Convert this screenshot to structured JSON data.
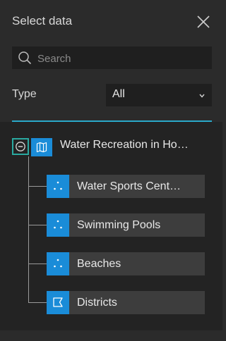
{
  "panel": {
    "title": "Select data",
    "close_icon": "close-icon"
  },
  "search": {
    "placeholder": "Search",
    "value": "",
    "icon": "search-icon"
  },
  "type_filter": {
    "label": "Type",
    "selected": "All",
    "icon": "chevron-down-icon"
  },
  "tree": {
    "parent": {
      "label": "Water Recreation in Ho…",
      "icon": "map-icon",
      "toggle_icon": "collapse-minus-icon"
    },
    "children": [
      {
        "label": "Water Sports Cent…",
        "icon": "point-layer-icon"
      },
      {
        "label": "Swimming Pools",
        "icon": "point-layer-icon"
      },
      {
        "label": "Beaches",
        "icon": "point-layer-icon"
      },
      {
        "label": "Districts",
        "icon": "polygon-layer-icon"
      }
    ]
  },
  "colors": {
    "accent": "#2aa9c9",
    "layer_icon_bg": "#1a8cd8",
    "focus_ring": "#2aa9a0"
  }
}
